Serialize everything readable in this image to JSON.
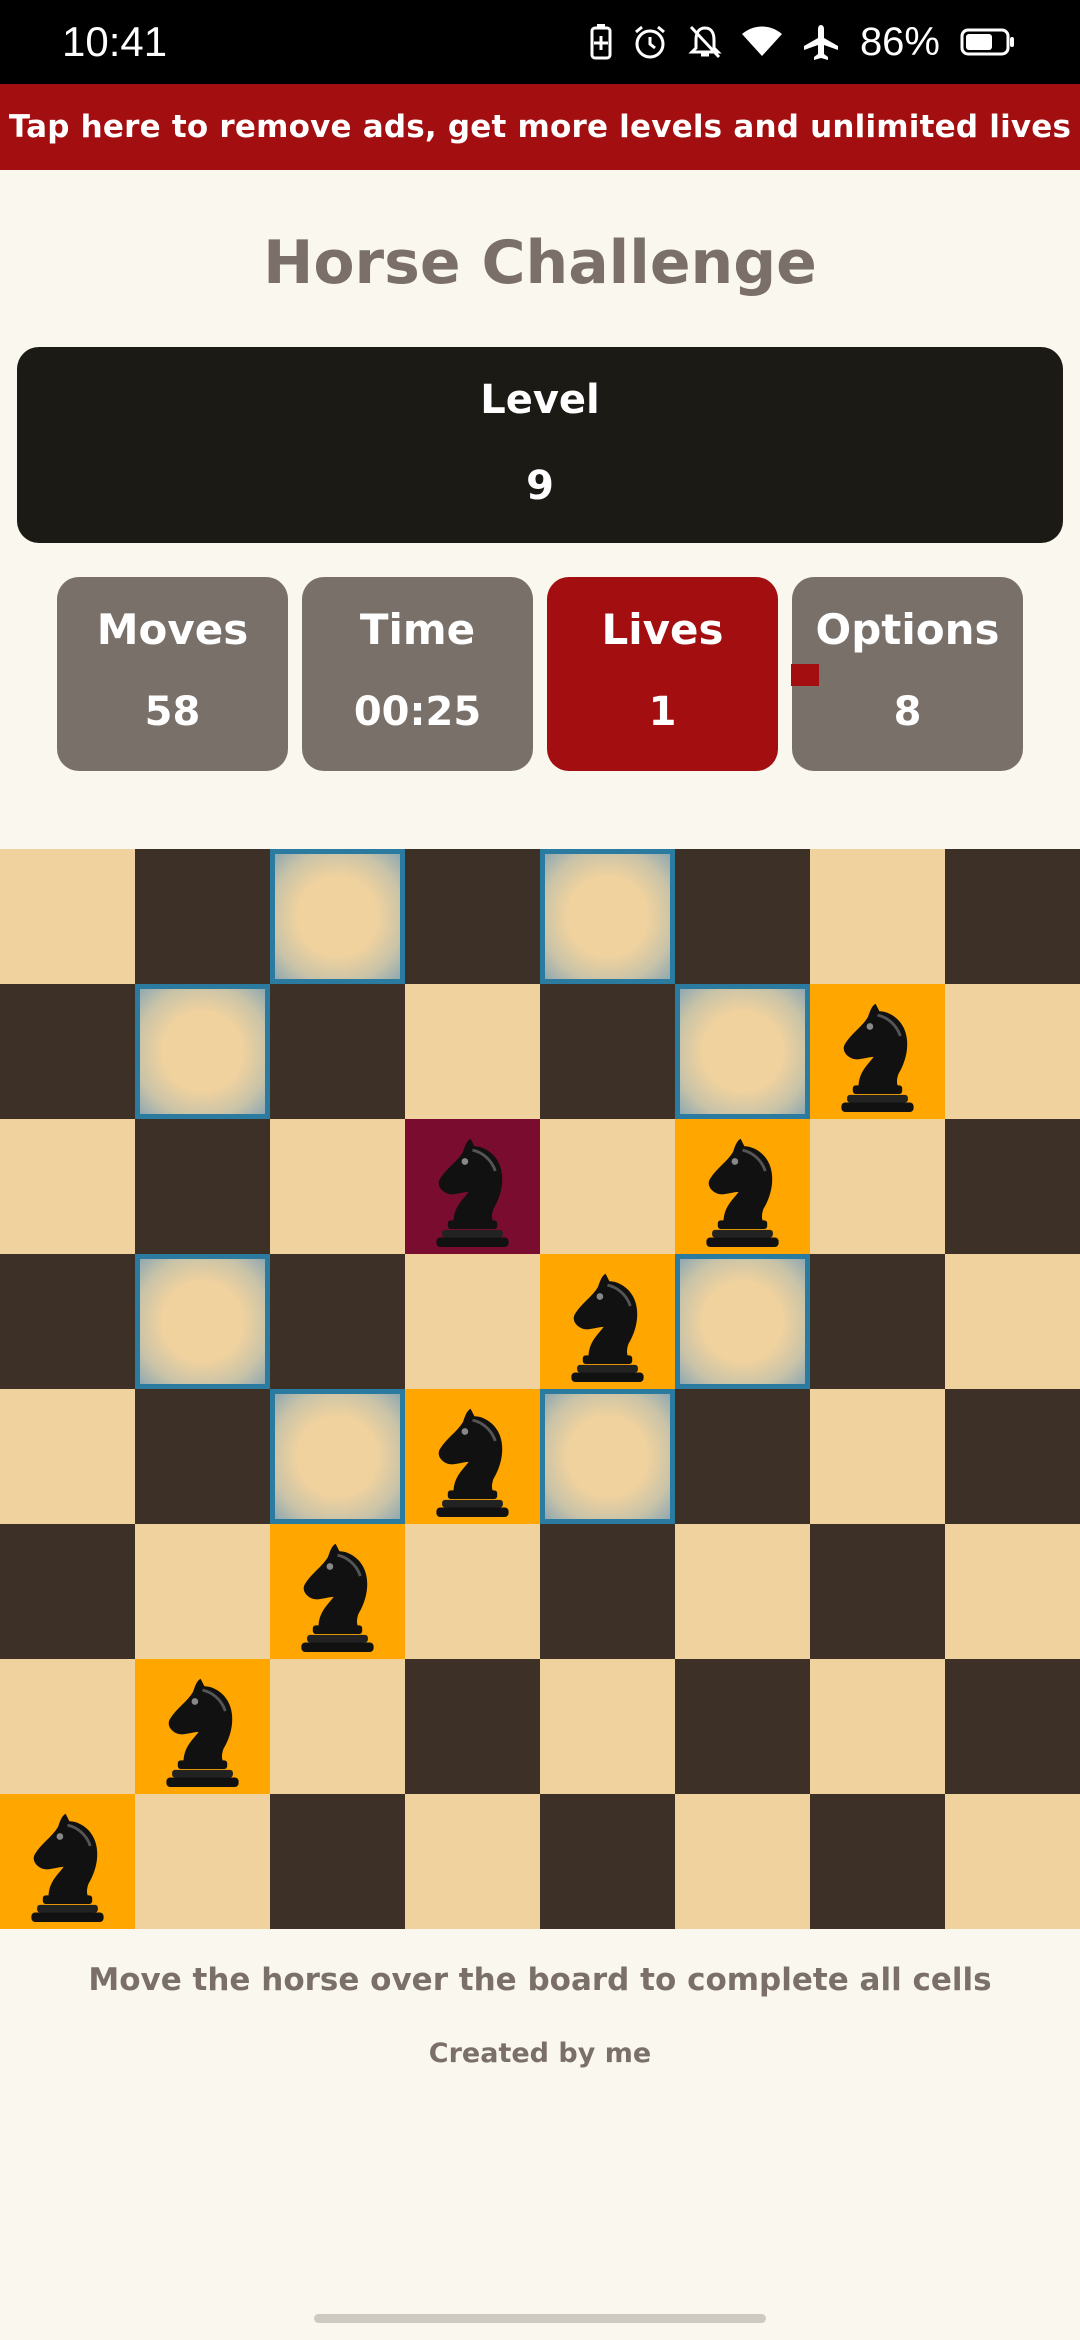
{
  "status_bar": {
    "time": "10:41",
    "icons": [
      "battery-saver-icon",
      "alarm-icon",
      "bell-off-icon",
      "wifi-icon",
      "airplane-icon",
      "battery-icon"
    ],
    "battery_percent": "86%"
  },
  "ad_banner": {
    "text": "Tap here to remove ads, get more levels and unlimited lives"
  },
  "title": "Horse Challenge",
  "level": {
    "label": "Level",
    "value": "9"
  },
  "stats": [
    {
      "label": "Moves",
      "value": "58"
    },
    {
      "label": "Time",
      "value": "00:25"
    },
    {
      "label": "Lives",
      "value": "1"
    },
    {
      "label": "Options",
      "value": "8"
    }
  ],
  "board": {
    "size": 8,
    "colors": {
      "light": "#f0d29e",
      "dark": "#3d3127",
      "visited": "#ffa600",
      "current": "#7a0d2f",
      "hint_border": "#2b7aa0"
    },
    "rows": [
      [
        "",
        "",
        "hint",
        "",
        "hint",
        "",
        "",
        ""
      ],
      [
        "",
        "hint",
        "",
        "",
        "",
        "hint",
        "visited",
        ""
      ],
      [
        "",
        "",
        "",
        "current",
        "",
        "visited",
        "",
        ""
      ],
      [
        "",
        "hint",
        "",
        "",
        "visited",
        "hint",
        "",
        ""
      ],
      [
        "",
        "",
        "hint",
        "visited",
        "hint",
        "",
        "",
        ""
      ],
      [
        "",
        "",
        "visited",
        "",
        "",
        "",
        "",
        ""
      ],
      [
        "",
        "visited",
        "",
        "",
        "",
        "",
        "",
        ""
      ],
      [
        "visited",
        "",
        "",
        "",
        "",
        "",
        "",
        ""
      ]
    ]
  },
  "footer": {
    "instruction": "Move the horse over the board to complete all cells",
    "credit": "Created by me"
  },
  "accent_colors": {
    "brand_red": "#a30e10",
    "stat_gray": "#79706a",
    "level_bg": "#1c1a15"
  }
}
